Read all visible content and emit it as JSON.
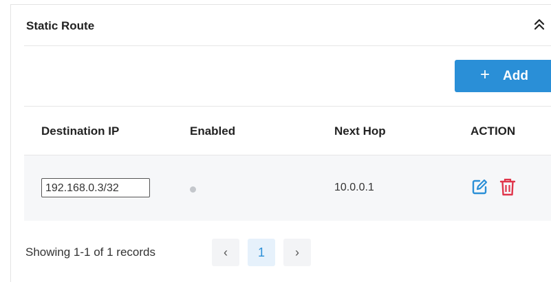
{
  "panel": {
    "title": "Static Route",
    "collapse_icon": "double-chevron-up-icon"
  },
  "toolbar": {
    "add_plus": "+",
    "add_label": "Add",
    "add_icon": "plus-icon"
  },
  "table": {
    "columns": [
      "Destination IP",
      "Enabled",
      "Next Hop",
      "ACTION"
    ],
    "rows": [
      {
        "destination_ip": "192.168.0.3/32",
        "enabled": false,
        "next_hop": "10.0.0.1",
        "actions": [
          "edit-icon",
          "delete-icon"
        ]
      }
    ]
  },
  "pagination": {
    "records_text": "Showing 1-1 of 1 records",
    "prev": "‹",
    "current_page": "1",
    "next": "›"
  },
  "colors": {
    "accent": "#2a8fd7",
    "delete": "#e0344a",
    "enabled_off": "#c4c7cc",
    "row_bg": "#f6f7f9"
  }
}
